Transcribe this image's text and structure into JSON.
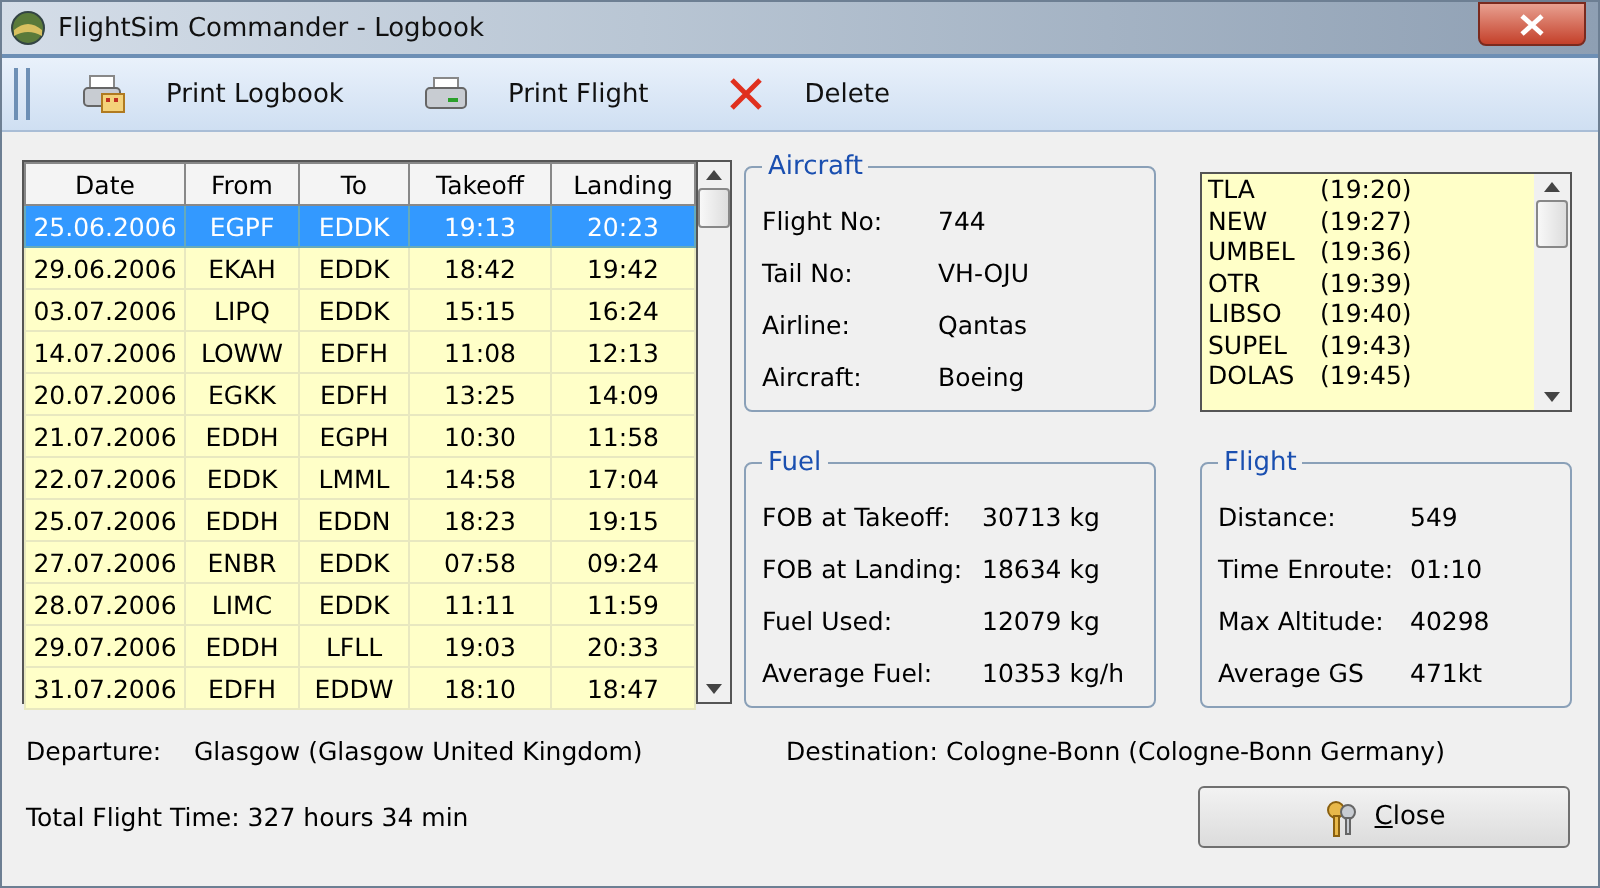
{
  "window": {
    "title": "FlightSim Commander - Logbook"
  },
  "toolbar": [
    {
      "kind": "print_logbook",
      "label": "Print Logbook"
    },
    {
      "kind": "print_flight",
      "label": "Print Flight"
    },
    {
      "kind": "delete",
      "label": "Delete"
    }
  ],
  "table": {
    "columns": [
      "Date",
      "From",
      "To",
      "Takeoff",
      "Landing"
    ],
    "rows": [
      {
        "cells": [
          "25.06.2006",
          "EGPF",
          "EDDK",
          "19:13",
          "20:23"
        ],
        "selected": true
      },
      {
        "cells": [
          "29.06.2006",
          "EKAH",
          "EDDK",
          "18:42",
          "19:42"
        ],
        "selected": false
      },
      {
        "cells": [
          "03.07.2006",
          "LIPQ",
          "EDDK",
          "15:15",
          "16:24"
        ],
        "selected": false
      },
      {
        "cells": [
          "14.07.2006",
          "LOWW",
          "EDFH",
          "11:08",
          "12:13"
        ],
        "selected": false
      },
      {
        "cells": [
          "20.07.2006",
          "EGKK",
          "EDFH",
          "13:25",
          "14:09"
        ],
        "selected": false
      },
      {
        "cells": [
          "21.07.2006",
          "EDDH",
          "EGPH",
          "10:30",
          "11:58"
        ],
        "selected": false
      },
      {
        "cells": [
          "22.07.2006",
          "EDDK",
          "LMML",
          "14:58",
          "17:04"
        ],
        "selected": false
      },
      {
        "cells": [
          "25.07.2006",
          "EDDH",
          "EDDN",
          "18:23",
          "19:15"
        ],
        "selected": false
      },
      {
        "cells": [
          "27.07.2006",
          "ENBR",
          "EDDK",
          "07:58",
          "09:24"
        ],
        "selected": false
      },
      {
        "cells": [
          "28.07.2006",
          "LIMC",
          "EDDK",
          "11:11",
          "11:59"
        ],
        "selected": false
      },
      {
        "cells": [
          "29.07.2006",
          "EDDH",
          "LFLL",
          "19:03",
          "20:33"
        ],
        "selected": false
      },
      {
        "cells": [
          "31.07.2006",
          "EDFH",
          "EDDW",
          "18:10",
          "18:47"
        ],
        "selected": false
      }
    ]
  },
  "aircraft": {
    "title": "Aircraft",
    "fields": [
      {
        "label": "Flight No:",
        "value": "744"
      },
      {
        "label": "Tail No:",
        "value": "VH-OJU"
      },
      {
        "label": "Airline:",
        "value": "Qantas"
      },
      {
        "label": "Aircraft:",
        "value": "Boeing"
      }
    ]
  },
  "waypoints": [
    {
      "name": "TLA",
      "time": "(19:20)"
    },
    {
      "name": "NEW",
      "time": "(19:27)"
    },
    {
      "name": "UMBEL",
      "time": "(19:36)"
    },
    {
      "name": "OTR",
      "time": "(19:39)"
    },
    {
      "name": "LIBSO",
      "time": "(19:40)"
    },
    {
      "name": "SUPEL",
      "time": "(19:43)"
    },
    {
      "name": "DOLAS",
      "time": "(19:45)"
    }
  ],
  "fuel": {
    "title": "Fuel",
    "fields": [
      {
        "label": "FOB at Takeoff:",
        "value": "30713 kg"
      },
      {
        "label": "FOB at Landing:",
        "value": "18634 kg"
      },
      {
        "label": "Fuel Used:",
        "value": "12079 kg"
      },
      {
        "label": "Average Fuel:",
        "value": "10353 kg/h"
      }
    ]
  },
  "flight": {
    "title": "Flight",
    "fields": [
      {
        "label": "Distance:",
        "value": "549"
      },
      {
        "label": "Time Enroute:",
        "value": "01:10"
      },
      {
        "label": "Max Altitude:",
        "value": "40298"
      },
      {
        "label": "Average GS",
        "value": "471kt"
      }
    ]
  },
  "departure": {
    "label": "Departure:",
    "value": "Glasgow (Glasgow United Kingdom)"
  },
  "destination": {
    "label": "Destination:",
    "value": "Cologne-Bonn (Cologne-Bonn Germany)"
  },
  "total_flight_time": "Total Flight Time: 327 hours 34 min",
  "close_button": {
    "label": "Close",
    "mnemonic_underlined": true
  }
}
